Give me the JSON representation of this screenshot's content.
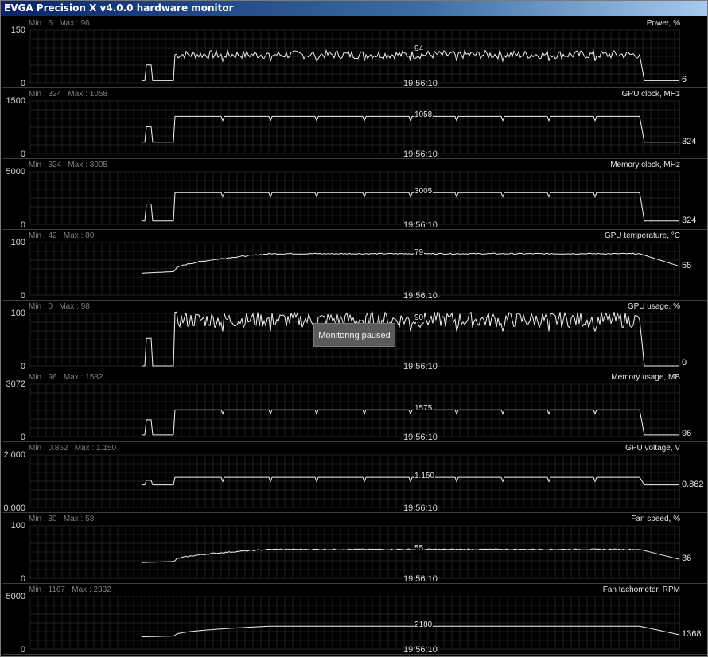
{
  "window": {
    "title": "EVGA Precision X v4.0.0 hardware monitor"
  },
  "tooltip": "Monitoring paused",
  "time_label": "19:56:10",
  "chart_data": [
    {
      "type": "line",
      "title": "Power, %",
      "min_label": "Min : 6",
      "max_label": "Max : 96",
      "ylim_labels": [
        "0",
        "150"
      ],
      "ylim": [
        0,
        150
      ],
      "current_label": "94",
      "end_label": "6",
      "series": {
        "start": 6,
        "plateau": 80,
        "end": 6,
        "noise": 12
      }
    },
    {
      "type": "line",
      "title": "GPU clock, MHz",
      "min_label": "Min : 324",
      "max_label": "Max : 1058",
      "ylim_labels": [
        "0",
        "1500"
      ],
      "ylim": [
        0,
        1500
      ],
      "current_label": "1058",
      "end_label": "324",
      "series": {
        "start": 324,
        "plateau": 1058,
        "end": 324,
        "noise": 0
      }
    },
    {
      "type": "line",
      "title": "Memory clock, MHz",
      "min_label": "Min : 324",
      "max_label": "Max : 3005",
      "ylim_labels": [
        "0",
        "5000"
      ],
      "ylim": [
        0,
        5000
      ],
      "current_label": "3005",
      "end_label": "324",
      "series": {
        "start": 324,
        "plateau": 3005,
        "end": 324,
        "noise": 0
      }
    },
    {
      "type": "line",
      "title": "GPU temperature, °C",
      "min_label": "Min : 42",
      "max_label": "Max : 80",
      "ylim_labels": [
        "0",
        "100"
      ],
      "ylim": [
        0,
        100
      ],
      "current_label": "79",
      "end_label": "55",
      "series": {
        "start": 42,
        "plateau": 79,
        "end": 55,
        "noise": 1
      }
    },
    {
      "type": "line",
      "title": "GPU usage, %",
      "min_label": "Min : 0",
      "max_label": "Max : 98",
      "ylim_labels": [
        "0",
        "100"
      ],
      "ylim": [
        0,
        100
      ],
      "current_label": "90",
      "end_label": "0",
      "series": {
        "start": 0,
        "plateau": 88,
        "end": 0,
        "noise": 15
      }
    },
    {
      "type": "line",
      "title": "Memory usage, MB",
      "min_label": "Min : 96",
      "max_label": "Max : 1582",
      "ylim_labels": [
        "0",
        "3072"
      ],
      "ylim": [
        0,
        3072
      ],
      "current_label": "1575",
      "end_label": "96",
      "series": {
        "start": 96,
        "plateau": 1575,
        "end": 96,
        "noise": 0
      }
    },
    {
      "type": "line",
      "title": "GPU voltage, V",
      "min_label": "Min : 0.862",
      "max_label": "Max : 1.150",
      "ylim_labels": [
        "0.000",
        "2.000"
      ],
      "ylim": [
        0,
        2
      ],
      "current_label": "1.150",
      "end_label": "0.862",
      "series": {
        "start": 0.862,
        "plateau": 1.15,
        "end": 0.862,
        "noise": 0
      }
    },
    {
      "type": "line",
      "title": "Fan speed, %",
      "min_label": "Min : 30",
      "max_label": "Max : 58",
      "ylim_labels": [
        "0",
        "100"
      ],
      "ylim": [
        0,
        100
      ],
      "current_label": "55",
      "end_label": "36",
      "series": {
        "start": 30,
        "plateau": 55,
        "end": 36,
        "noise": 1
      }
    },
    {
      "type": "line",
      "title": "Fan tachometer, RPM",
      "min_label": "Min : 1167",
      "max_label": "Max : 2332",
      "ylim_labels": [
        "0",
        "5000"
      ],
      "ylim": [
        0,
        5000
      ],
      "current_label": "2180",
      "end_label": "1368",
      "series": {
        "start": 1167,
        "plateau": 2180,
        "end": 1368,
        "noise": 0
      }
    }
  ]
}
